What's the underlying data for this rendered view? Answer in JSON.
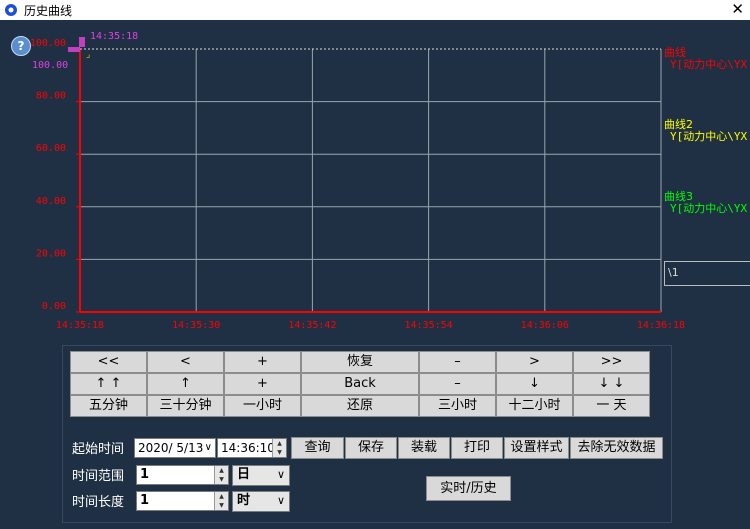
{
  "window": {
    "title": "历史曲线",
    "close_glyph": "✕"
  },
  "chart_data": {
    "type": "line",
    "series": [
      {
        "name": "曲线",
        "tag": "Y[动力中心\\YX",
        "color": "#ff0000",
        "values": []
      },
      {
        "name": "曲线2",
        "tag": "Y[动力中心\\YX",
        "color": "#ffff00",
        "values": []
      },
      {
        "name": "曲线3",
        "tag": "Y[动力中心\\YX",
        "color": "#00ff00",
        "values": []
      }
    ],
    "x_ticks": [
      "14:35:18",
      "14:35:30",
      "14:35:42",
      "14:35:54",
      "14:36:06",
      "14:36:18"
    ],
    "y_ticks": [
      "0.00",
      "20.00",
      "40.00",
      "60.00",
      "80.00",
      "100.00"
    ],
    "ylim": [
      0,
      100
    ],
    "grid": true,
    "cursor": {
      "time": "14:35:18",
      "value": "100.00"
    },
    "legend_box_text": "\\1"
  },
  "nav": {
    "row1": [
      "<<",
      "<",
      "+",
      "恢复",
      "–",
      ">",
      ">>"
    ],
    "row2": [
      "↑ ↑",
      "↑",
      "+",
      "Back",
      "–",
      "↓",
      "↓ ↓"
    ],
    "row3": [
      "五分钟",
      "三十分钟",
      "一小时",
      "还原",
      "三小时",
      "十二小时",
      "一 天"
    ]
  },
  "query": {
    "start_label": "起始时间",
    "date": "2020/ 5/13",
    "time": "14:36:10",
    "buttons": [
      "查询",
      "保存",
      "装载",
      "打印",
      "设置样式",
      "去除无效数据"
    ],
    "range_label": "时间范围",
    "range_value": "1",
    "range_unit": "日",
    "length_label": "时间长度",
    "length_value": "1",
    "length_unit": "时",
    "toggle_label": "实时/历史"
  },
  "colors": {
    "background": "#1f3044",
    "axis": "#ff0000",
    "grid": "#9aa4b0"
  }
}
